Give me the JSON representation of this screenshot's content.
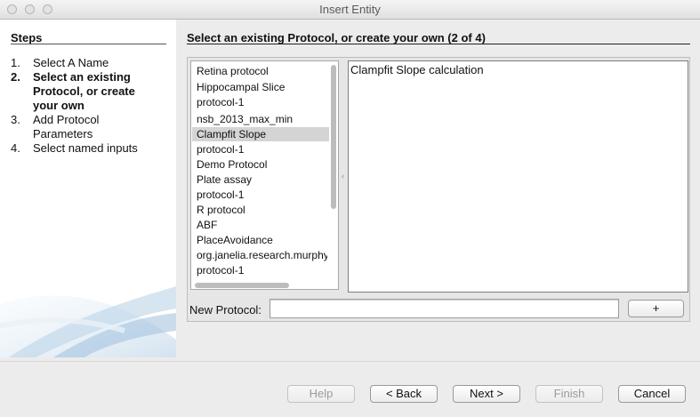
{
  "window": {
    "title": "Insert Entity"
  },
  "steps": {
    "title": "Steps",
    "items": [
      {
        "num": "1.",
        "label": "Select A Name"
      },
      {
        "num": "2.",
        "label": "Select an existing Protocol, or create your own"
      },
      {
        "num": "3.",
        "label": "Add Protocol Parameters"
      },
      {
        "num": "4.",
        "label": "Select named inputs"
      }
    ]
  },
  "main": {
    "heading": "Select an existing Protocol, or create your own (2 of 4)",
    "protocols": [
      "Retina protocol",
      "Hippocampal Slice",
      "protocol-1",
      "nsb_2013_max_min",
      "Clampfit Slope",
      "protocol-1",
      "Demo Protocol",
      "Plate assay",
      "protocol-1",
      "R protocol",
      "ABF",
      "PlaceAvoidance",
      "org.janelia.research.murphy",
      "protocol-1"
    ],
    "selected_protocol": "Clampfit Slope",
    "detail_text": "Clampfit Slope calculation",
    "new_protocol_label": "New Protocol:",
    "new_protocol_value": "",
    "add_button_label": "+"
  },
  "footer": {
    "help": "Help",
    "back": "< Back",
    "next": "Next >",
    "finish": "Finish",
    "cancel": "Cancel"
  }
}
